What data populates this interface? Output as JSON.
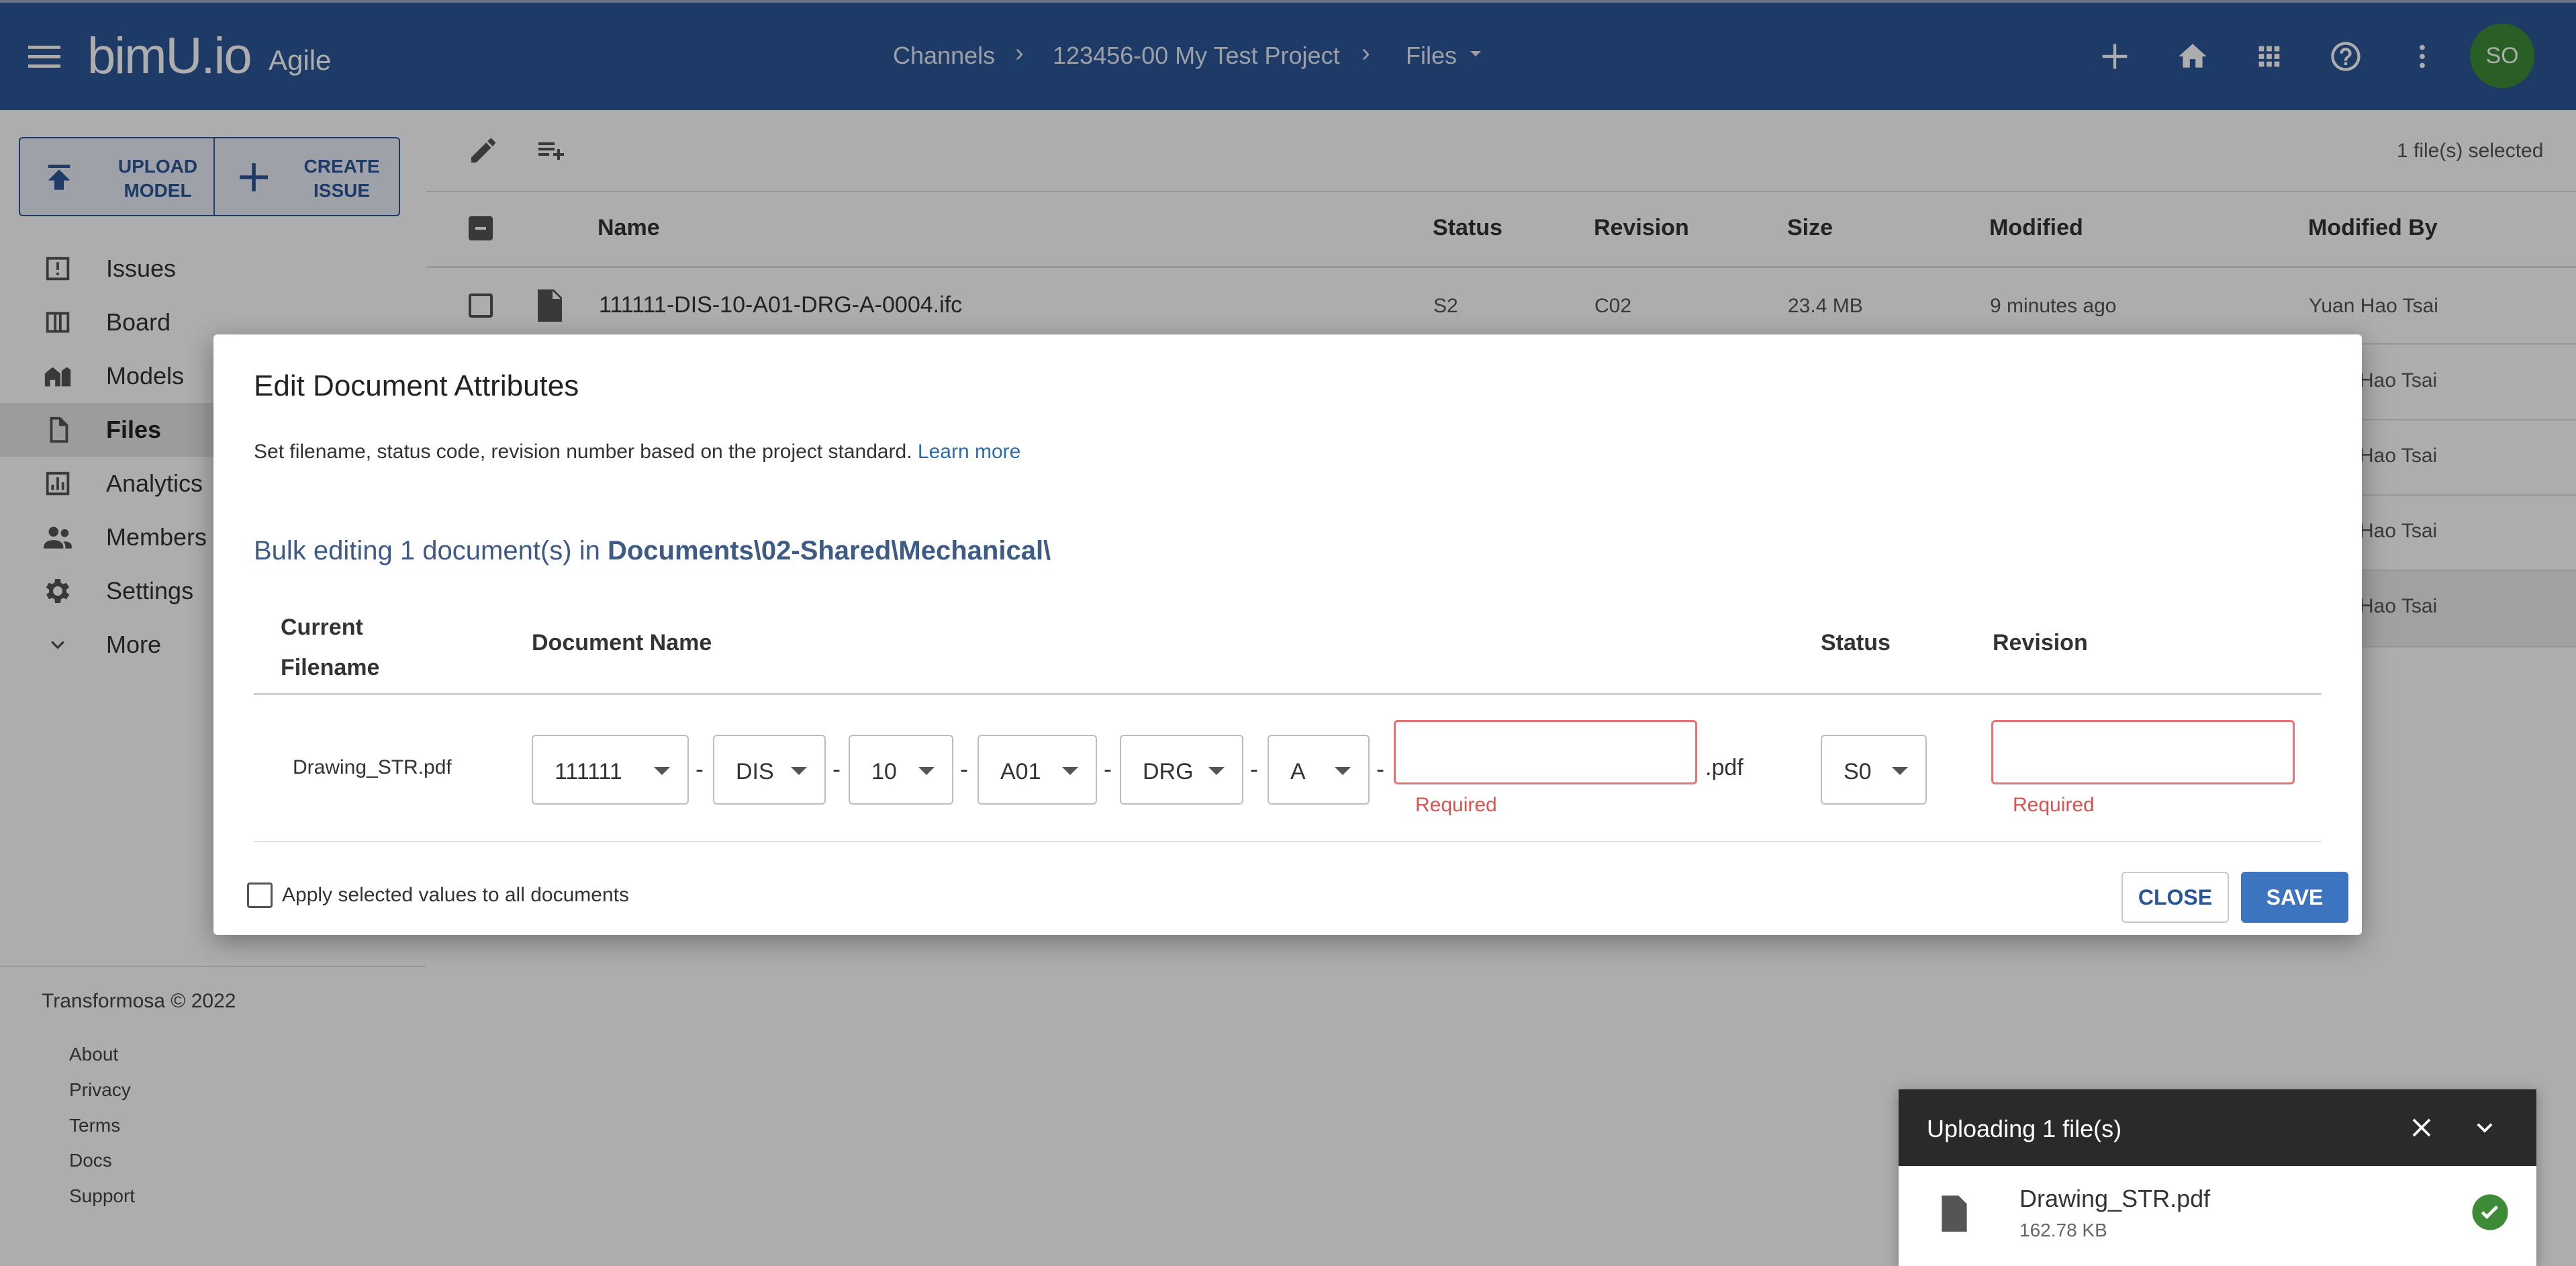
{
  "header": {
    "logo": "bimU.io",
    "product": "Agile",
    "breadcrumbs": [
      "Channels",
      "123456-00 My Test Project",
      "Files"
    ],
    "avatar_initials": "SO",
    "colors": {
      "bar": "#2b5797",
      "avatar": "#3d8b37"
    }
  },
  "sidebar": {
    "upload_button": [
      "UPLOAD",
      "MODEL"
    ],
    "create_button": [
      "CREATE",
      "ISSUE"
    ],
    "items": [
      {
        "label": "Issues",
        "icon": "issue-icon"
      },
      {
        "label": "Board",
        "icon": "board-icon"
      },
      {
        "label": "Models",
        "icon": "models-icon"
      },
      {
        "label": "Files",
        "icon": "file-icon",
        "active": true
      },
      {
        "label": "Analytics",
        "icon": "analytics-icon"
      },
      {
        "label": "Members",
        "icon": "members-icon"
      },
      {
        "label": "Settings",
        "icon": "gear-icon"
      },
      {
        "label": "More",
        "icon": "chevron-down-icon"
      }
    ],
    "copyright": "Transformosa © 2022",
    "footer_links": [
      "About",
      "Privacy",
      "Terms",
      "Docs",
      "Support"
    ]
  },
  "files": {
    "selected_count": "1 file(s) selected",
    "columns": [
      "Name",
      "Status",
      "Revision",
      "Size",
      "Modified",
      "Modified By"
    ],
    "rows": [
      {
        "name": "111111-DIS-10-A01-DRG-A-0004.ifc",
        "status": "S2",
        "revision": "C02",
        "size": "23.4 MB",
        "modified": "9 minutes ago",
        "modified_by": "Yuan Hao Tsai"
      }
    ],
    "partial_modified_by": [
      "Hao Tsai",
      "Hao Tsai",
      "Hao Tsai",
      "Hao Tsai"
    ]
  },
  "dialog": {
    "title": "Edit Document Attributes",
    "description": "Set filename, status code, revision number based on the project standard.",
    "learn_more": "Learn more",
    "bulk_prefix": "Bulk editing 1 document(s) in",
    "bulk_path": "Documents\\02-Shared\\Mechanical\\",
    "columns": {
      "current_filename": [
        "Current",
        "Filename"
      ],
      "document_name": "Document Name",
      "status": "Status",
      "revision": "Revision"
    },
    "row": {
      "current_filename": "Drawing_STR.pdf",
      "segments": [
        "111111",
        "DIS",
        "10",
        "A01",
        "DRG",
        "A"
      ],
      "separator": "-",
      "number_value": "",
      "extension": ".pdf",
      "status": "S0",
      "revision_value": "",
      "required": "Required"
    },
    "apply_all_label": "Apply selected values to all documents",
    "close_label": "CLOSE",
    "save_label": "SAVE"
  },
  "upload": {
    "title": "Uploading 1 file(s)",
    "file_name": "Drawing_STR.pdf",
    "file_size": "162.78 KB"
  }
}
